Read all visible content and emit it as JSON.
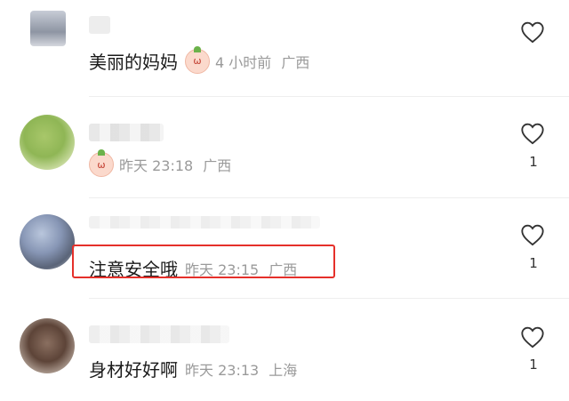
{
  "comments": [
    {
      "content": "美丽的妈妈",
      "time": "4 小时前",
      "location": "广西",
      "likes": "",
      "has_sticker": true
    },
    {
      "content": "",
      "time": "昨天 23:18",
      "location": "广西",
      "likes": "1",
      "has_sticker": true
    },
    {
      "content": "注意安全哦",
      "time": "昨天 23:15",
      "location": "广西",
      "likes": "1",
      "has_sticker": false
    },
    {
      "content": "身材好好啊",
      "time": "昨天 23:13",
      "location": "上海",
      "likes": "1",
      "has_sticker": false
    }
  ],
  "highlight_color": "#e5302a",
  "icons": {
    "like": "heart-outline-icon"
  }
}
